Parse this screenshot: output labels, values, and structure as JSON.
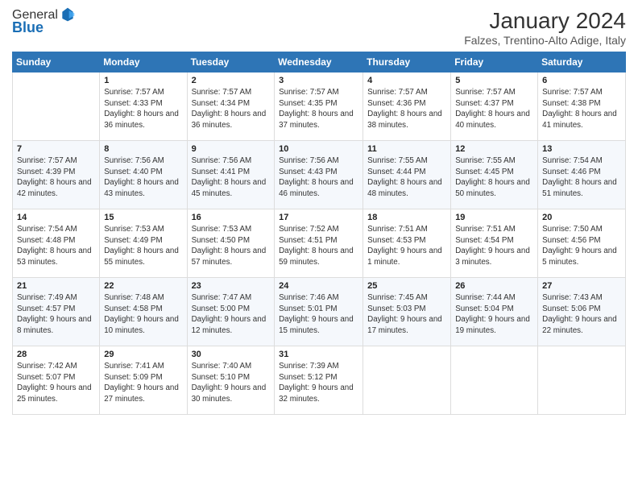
{
  "header": {
    "logo_general": "General",
    "logo_blue": "Blue",
    "month_title": "January 2024",
    "subtitle": "Falzes, Trentino-Alto Adige, Italy"
  },
  "weekdays": [
    "Sunday",
    "Monday",
    "Tuesday",
    "Wednesday",
    "Thursday",
    "Friday",
    "Saturday"
  ],
  "weeks": [
    [
      {
        "day": "",
        "sunrise": "",
        "sunset": "",
        "daylight": ""
      },
      {
        "day": "1",
        "sunrise": "Sunrise: 7:57 AM",
        "sunset": "Sunset: 4:33 PM",
        "daylight": "Daylight: 8 hours and 36 minutes."
      },
      {
        "day": "2",
        "sunrise": "Sunrise: 7:57 AM",
        "sunset": "Sunset: 4:34 PM",
        "daylight": "Daylight: 8 hours and 36 minutes."
      },
      {
        "day": "3",
        "sunrise": "Sunrise: 7:57 AM",
        "sunset": "Sunset: 4:35 PM",
        "daylight": "Daylight: 8 hours and 37 minutes."
      },
      {
        "day": "4",
        "sunrise": "Sunrise: 7:57 AM",
        "sunset": "Sunset: 4:36 PM",
        "daylight": "Daylight: 8 hours and 38 minutes."
      },
      {
        "day": "5",
        "sunrise": "Sunrise: 7:57 AM",
        "sunset": "Sunset: 4:37 PM",
        "daylight": "Daylight: 8 hours and 40 minutes."
      },
      {
        "day": "6",
        "sunrise": "Sunrise: 7:57 AM",
        "sunset": "Sunset: 4:38 PM",
        "daylight": "Daylight: 8 hours and 41 minutes."
      }
    ],
    [
      {
        "day": "7",
        "sunrise": "Sunrise: 7:57 AM",
        "sunset": "Sunset: 4:39 PM",
        "daylight": "Daylight: 8 hours and 42 minutes."
      },
      {
        "day": "8",
        "sunrise": "Sunrise: 7:56 AM",
        "sunset": "Sunset: 4:40 PM",
        "daylight": "Daylight: 8 hours and 43 minutes."
      },
      {
        "day": "9",
        "sunrise": "Sunrise: 7:56 AM",
        "sunset": "Sunset: 4:41 PM",
        "daylight": "Daylight: 8 hours and 45 minutes."
      },
      {
        "day": "10",
        "sunrise": "Sunrise: 7:56 AM",
        "sunset": "Sunset: 4:43 PM",
        "daylight": "Daylight: 8 hours and 46 minutes."
      },
      {
        "day": "11",
        "sunrise": "Sunrise: 7:55 AM",
        "sunset": "Sunset: 4:44 PM",
        "daylight": "Daylight: 8 hours and 48 minutes."
      },
      {
        "day": "12",
        "sunrise": "Sunrise: 7:55 AM",
        "sunset": "Sunset: 4:45 PM",
        "daylight": "Daylight: 8 hours and 50 minutes."
      },
      {
        "day": "13",
        "sunrise": "Sunrise: 7:54 AM",
        "sunset": "Sunset: 4:46 PM",
        "daylight": "Daylight: 8 hours and 51 minutes."
      }
    ],
    [
      {
        "day": "14",
        "sunrise": "Sunrise: 7:54 AM",
        "sunset": "Sunset: 4:48 PM",
        "daylight": "Daylight: 8 hours and 53 minutes."
      },
      {
        "day": "15",
        "sunrise": "Sunrise: 7:53 AM",
        "sunset": "Sunset: 4:49 PM",
        "daylight": "Daylight: 8 hours and 55 minutes."
      },
      {
        "day": "16",
        "sunrise": "Sunrise: 7:53 AM",
        "sunset": "Sunset: 4:50 PM",
        "daylight": "Daylight: 8 hours and 57 minutes."
      },
      {
        "day": "17",
        "sunrise": "Sunrise: 7:52 AM",
        "sunset": "Sunset: 4:51 PM",
        "daylight": "Daylight: 8 hours and 59 minutes."
      },
      {
        "day": "18",
        "sunrise": "Sunrise: 7:51 AM",
        "sunset": "Sunset: 4:53 PM",
        "daylight": "Daylight: 9 hours and 1 minute."
      },
      {
        "day": "19",
        "sunrise": "Sunrise: 7:51 AM",
        "sunset": "Sunset: 4:54 PM",
        "daylight": "Daylight: 9 hours and 3 minutes."
      },
      {
        "day": "20",
        "sunrise": "Sunrise: 7:50 AM",
        "sunset": "Sunset: 4:56 PM",
        "daylight": "Daylight: 9 hours and 5 minutes."
      }
    ],
    [
      {
        "day": "21",
        "sunrise": "Sunrise: 7:49 AM",
        "sunset": "Sunset: 4:57 PM",
        "daylight": "Daylight: 9 hours and 8 minutes."
      },
      {
        "day": "22",
        "sunrise": "Sunrise: 7:48 AM",
        "sunset": "Sunset: 4:58 PM",
        "daylight": "Daylight: 9 hours and 10 minutes."
      },
      {
        "day": "23",
        "sunrise": "Sunrise: 7:47 AM",
        "sunset": "Sunset: 5:00 PM",
        "daylight": "Daylight: 9 hours and 12 minutes."
      },
      {
        "day": "24",
        "sunrise": "Sunrise: 7:46 AM",
        "sunset": "Sunset: 5:01 PM",
        "daylight": "Daylight: 9 hours and 15 minutes."
      },
      {
        "day": "25",
        "sunrise": "Sunrise: 7:45 AM",
        "sunset": "Sunset: 5:03 PM",
        "daylight": "Daylight: 9 hours and 17 minutes."
      },
      {
        "day": "26",
        "sunrise": "Sunrise: 7:44 AM",
        "sunset": "Sunset: 5:04 PM",
        "daylight": "Daylight: 9 hours and 19 minutes."
      },
      {
        "day": "27",
        "sunrise": "Sunrise: 7:43 AM",
        "sunset": "Sunset: 5:06 PM",
        "daylight": "Daylight: 9 hours and 22 minutes."
      }
    ],
    [
      {
        "day": "28",
        "sunrise": "Sunrise: 7:42 AM",
        "sunset": "Sunset: 5:07 PM",
        "daylight": "Daylight: 9 hours and 25 minutes."
      },
      {
        "day": "29",
        "sunrise": "Sunrise: 7:41 AM",
        "sunset": "Sunset: 5:09 PM",
        "daylight": "Daylight: 9 hours and 27 minutes."
      },
      {
        "day": "30",
        "sunrise": "Sunrise: 7:40 AM",
        "sunset": "Sunset: 5:10 PM",
        "daylight": "Daylight: 9 hours and 30 minutes."
      },
      {
        "day": "31",
        "sunrise": "Sunrise: 7:39 AM",
        "sunset": "Sunset: 5:12 PM",
        "daylight": "Daylight: 9 hours and 32 minutes."
      },
      {
        "day": "",
        "sunrise": "",
        "sunset": "",
        "daylight": ""
      },
      {
        "day": "",
        "sunrise": "",
        "sunset": "",
        "daylight": ""
      },
      {
        "day": "",
        "sunrise": "",
        "sunset": "",
        "daylight": ""
      }
    ]
  ]
}
